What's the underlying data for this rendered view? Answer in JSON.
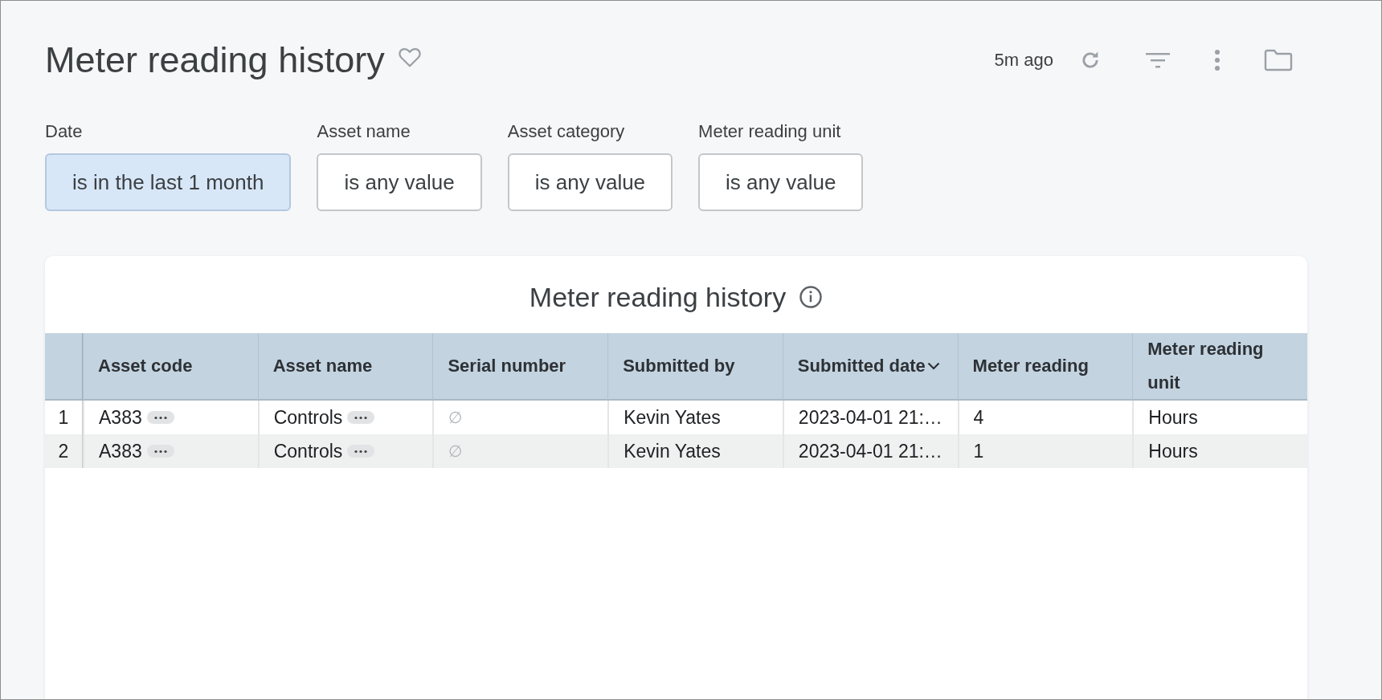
{
  "header": {
    "title": "Meter reading history",
    "updated": "5m ago"
  },
  "filters": [
    {
      "label": "Date",
      "value": "is in the last 1 month",
      "active": true
    },
    {
      "label": "Asset name",
      "value": "is any value",
      "active": false
    },
    {
      "label": "Asset category",
      "value": "is any value",
      "active": false
    },
    {
      "label": "Meter reading unit",
      "value": "is any value",
      "active": false
    }
  ],
  "table": {
    "title": "Meter reading history",
    "columns": [
      {
        "label": "Asset code",
        "sorted": false
      },
      {
        "label": "Asset name",
        "sorted": false
      },
      {
        "label": "Serial number",
        "sorted": false
      },
      {
        "label": "Submitted by",
        "sorted": false
      },
      {
        "label": "Submitted date",
        "sorted": true
      },
      {
        "label": "Meter reading",
        "sorted": false
      },
      {
        "label": "Meter reading unit",
        "sorted": false
      }
    ],
    "rows": [
      {
        "index": "1",
        "cells": [
          {
            "text": "A383",
            "kind": "expandable"
          },
          {
            "text": "Controls",
            "kind": "expandable"
          },
          {
            "text": "∅",
            "kind": "null"
          },
          {
            "text": "Kevin Yates",
            "kind": "plain"
          },
          {
            "text": "2023-04-01 21:…",
            "kind": "plain"
          },
          {
            "text": "4",
            "kind": "plain"
          },
          {
            "text": "Hours",
            "kind": "plain"
          }
        ]
      },
      {
        "index": "2",
        "cells": [
          {
            "text": "A383",
            "kind": "expandable"
          },
          {
            "text": "Controls",
            "kind": "expandable"
          },
          {
            "text": "∅",
            "kind": "null"
          },
          {
            "text": "Kevin Yates",
            "kind": "plain"
          },
          {
            "text": "2023-04-01 21:…",
            "kind": "plain"
          },
          {
            "text": "1",
            "kind": "plain"
          },
          {
            "text": "Hours",
            "kind": "plain"
          }
        ]
      }
    ]
  }
}
